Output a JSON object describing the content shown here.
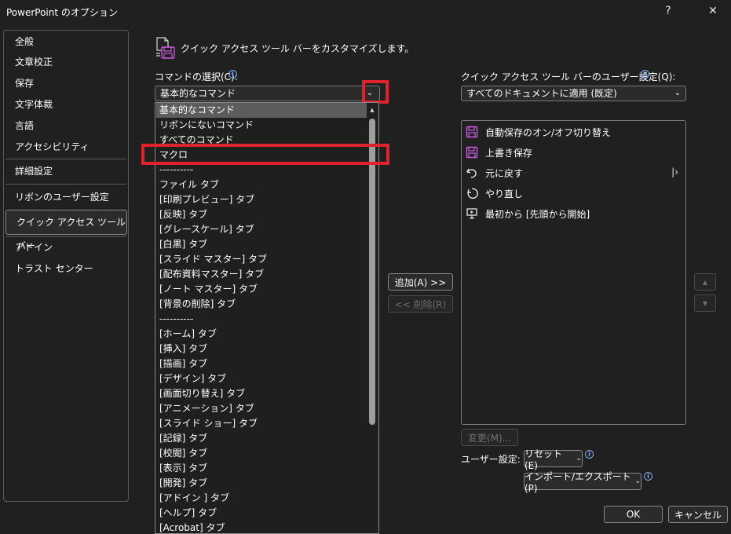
{
  "window": {
    "title": "PowerPoint のオプション",
    "help_label": "?",
    "close_label": "✕"
  },
  "sidebar": {
    "items": [
      {
        "label": "全般"
      },
      {
        "label": "文章校正"
      },
      {
        "label": "保存"
      },
      {
        "label": "文字体裁"
      },
      {
        "label": "言語"
      },
      {
        "label": "アクセシビリティ"
      },
      {
        "label": "詳細設定"
      },
      {
        "label": "リボンのユーザー設定"
      },
      {
        "label": "クイック アクセス ツール バー"
      },
      {
        "label": "アドイン"
      },
      {
        "label": "トラスト センター"
      }
    ],
    "selected": "クイック アクセス ツール バー"
  },
  "header": {
    "heading": "クイック アクセス ツール バーをカスタマイズします。"
  },
  "left_panel": {
    "label": "コマンドの選択(C):",
    "selected_value": "基本的なコマンド",
    "dropdown_items": [
      "基本的なコマンド",
      "リボンにないコマンド",
      "すべてのコマンド",
      "マクロ",
      "----------",
      "ファイル タブ",
      "[印刷プレビュー] タブ",
      "[反映] タブ",
      "[グレースケール] タブ",
      "[白黒] タブ",
      "[スライド マスター] タブ",
      "[配布資料マスター] タブ",
      "[ノート マスター] タブ",
      "[背景の削除] タブ",
      "----------",
      "[ホーム] タブ",
      "[挿入] タブ",
      "[描画] タブ",
      "[デザイン] タブ",
      "[画面切り替え] タブ",
      "[アニメーション] タブ",
      "[スライド ショー] タブ",
      "[記録] タブ",
      "[校閲] タブ",
      "[表示] タブ",
      "[開発] タブ",
      "[アドイン ] タブ",
      "[ヘルプ] タブ",
      "[Acrobat] タブ"
    ],
    "highlighted_index": 0,
    "marked_item": "マクロ"
  },
  "middle": {
    "add_label": "追加(A) >>",
    "remove_label": "<< 削除(R)"
  },
  "right_panel": {
    "label": "クイック アクセス ツール バーのユーザー設定(Q):",
    "selected_value": "すべてのドキュメントに適用 (既定)",
    "items": [
      {
        "label": "自動保存のオン/オフ切り替え",
        "icon": "save-icon"
      },
      {
        "label": "上書き保存",
        "icon": "save-icon"
      },
      {
        "label": "元に戻す",
        "icon": "undo-icon",
        "has_submenu": true
      },
      {
        "label": "やり直し",
        "icon": "redo-icon"
      },
      {
        "label": "最初から [先頭から開始]",
        "icon": "presentation-icon"
      }
    ],
    "modify_label": "変更(M)...",
    "user_settings_label": "ユーザー設定:",
    "reset_label": "リセット(E)",
    "import_export_label": "インポート/エクスポート(P)"
  },
  "footer": {
    "ok_label": "OK",
    "cancel_label": "キャンセル"
  },
  "colors": {
    "accent_save_icon": "#c35ad6",
    "highlight_box": "#e0232b",
    "info_icon": "#7fb2ff"
  }
}
